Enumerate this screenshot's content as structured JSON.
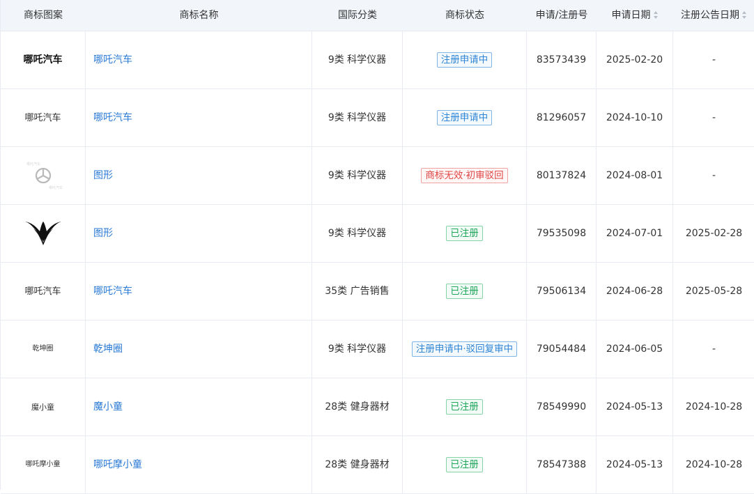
{
  "headers": {
    "logo": "商标图案",
    "name": "商标名称",
    "class": "国际分类",
    "status": "商标状态",
    "reg_no": "申请/注册号",
    "apply_date": "申请日期",
    "pub_date": "注册公告日期"
  },
  "rows": [
    {
      "logo_text": "哪吒汽车",
      "name": "哪吒汽车",
      "class": "9类 科学仪器",
      "status": "注册申请中",
      "status_color": "blue",
      "reg_no": "83573439",
      "apply_date": "2025-02-20",
      "pub_date": "-"
    },
    {
      "logo_text": "哪吒汽车",
      "name": "哪吒汽车",
      "class": "9类 科学仪器",
      "status": "注册申请中",
      "status_color": "blue",
      "reg_no": "81296057",
      "apply_date": "2024-10-10",
      "pub_date": "-"
    },
    {
      "logo_icon": "wheel-logo-icon",
      "name": "图形",
      "class": "9类 科学仪器",
      "status": "商标无效·初审驳回",
      "status_color": "red",
      "reg_no": "80137824",
      "apply_date": "2024-08-01",
      "pub_date": "-"
    },
    {
      "logo_icon": "wing-v-logo-icon",
      "name": "图形",
      "class": "9类 科学仪器",
      "status": "已注册",
      "status_color": "green",
      "reg_no": "79535098",
      "apply_date": "2024-07-01",
      "pub_date": "2025-02-28"
    },
    {
      "logo_text": "哪吒汽车",
      "name": "哪吒汽车",
      "class": "35类 广告销售",
      "status": "已注册",
      "status_color": "green",
      "reg_no": "79506134",
      "apply_date": "2024-06-28",
      "pub_date": "2025-05-28"
    },
    {
      "logo_text": "乾坤圈",
      "name": "乾坤圈",
      "class": "9类 科学仪器",
      "status": "注册申请中·驳回复审中",
      "status_color": "blue",
      "reg_no": "79054484",
      "apply_date": "2024-06-05",
      "pub_date": "-"
    },
    {
      "logo_text": "魔小童",
      "name": "魔小童",
      "class": "28类 健身器材",
      "status": "已注册",
      "status_color": "green",
      "reg_no": "78549990",
      "apply_date": "2024-05-13",
      "pub_date": "2024-10-28"
    },
    {
      "logo_text": "哪吒摩小童",
      "name": "哪吒摩小童",
      "class": "28类 健身器材",
      "status": "已注册",
      "status_color": "green",
      "reg_no": "78547388",
      "apply_date": "2024-05-13",
      "pub_date": "2024-10-28"
    }
  ]
}
